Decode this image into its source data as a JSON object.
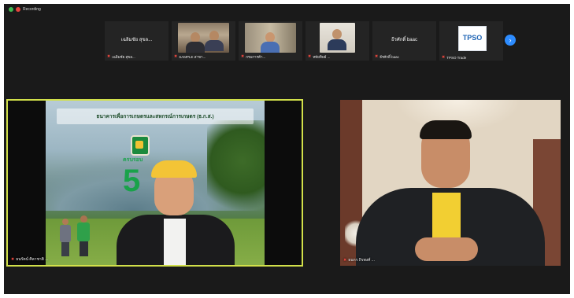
{
  "recording": {
    "label": "Recording",
    "dot_colors": [
      "#3fb950",
      "#e5463d"
    ]
  },
  "participants": [
    {
      "name_center": "เฉลิมชัย สุขล...",
      "label": "เฉลิมชัย สุขล...",
      "muted": true,
      "video": false
    },
    {
      "name_center": "",
      "label": "SAMPLE สาขา...",
      "muted": true,
      "video": "room"
    },
    {
      "name_center": "",
      "label": "กรมการค้า...",
      "muted": true,
      "video": "curtain"
    },
    {
      "name_center": "",
      "label": "หทัยทิพย์ ...",
      "muted": true,
      "video": "portrait"
    },
    {
      "name_center": "ธีรศักดิ์ baac",
      "label": "ธีรศักดิ์ baac",
      "muted": true,
      "video": false
    },
    {
      "name_center": "",
      "label": "TPSO Trade",
      "muted": true,
      "video": "logo",
      "logo_text": "TPSO"
    }
  ],
  "next_button": {
    "icon": "chevron-right-icon",
    "glyph": "›"
  },
  "tiles": {
    "left": {
      "label": "ธนรัตน์ ศิลาชาติ ...",
      "muted": true,
      "banner": "ธนาคารเพื่อการเกษตรและสหกรณ์การเกษตร (ธ.ก.ส.)",
      "big_number": "5",
      "sub_text": "ครบรอบ",
      "border_color": "#d2e04a"
    },
    "right": {
      "label": "ธนกร ถิรพงศ์ ...",
      "muted": true
    }
  }
}
